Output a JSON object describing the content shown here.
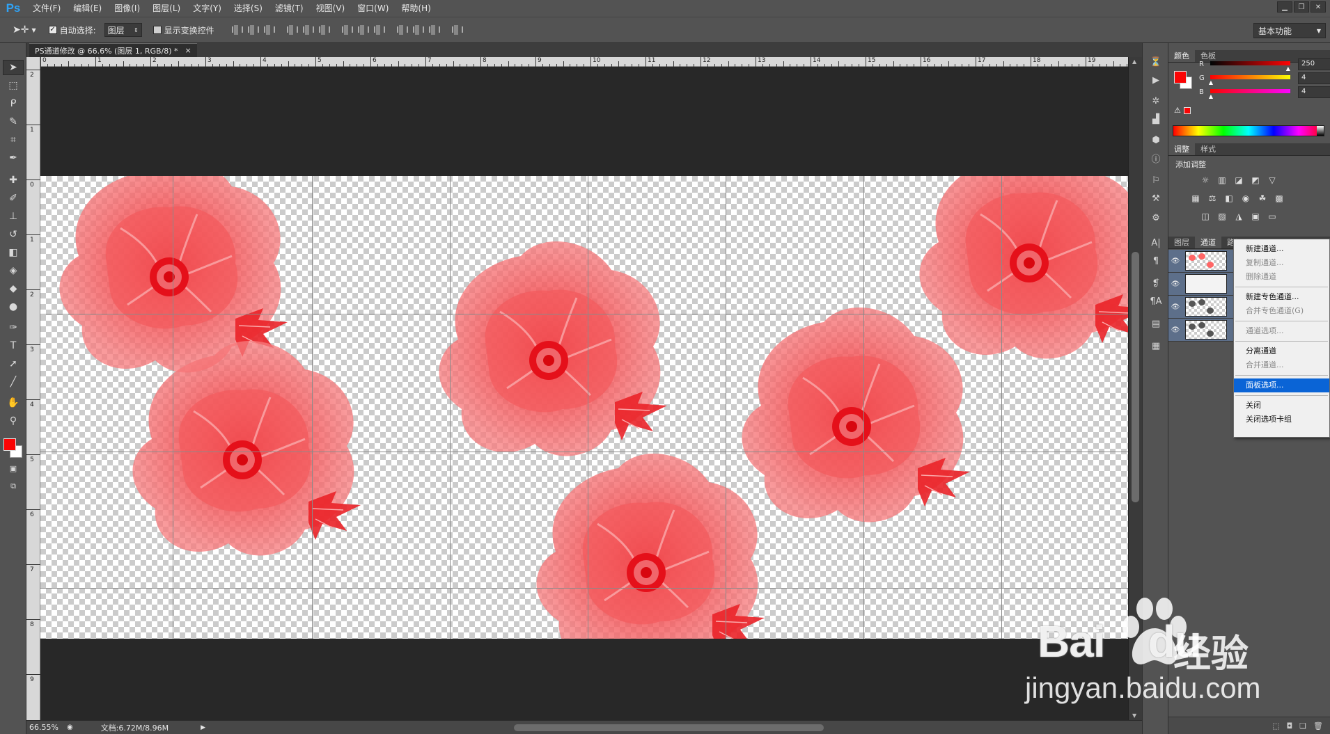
{
  "app": {
    "logo": "Ps"
  },
  "menu": [
    "文件(F)",
    "编辑(E)",
    "图像(I)",
    "图层(L)",
    "文字(Y)",
    "选择(S)",
    "滤镜(T)",
    "视图(V)",
    "窗口(W)",
    "帮助(H)"
  ],
  "options": {
    "auto_select_label": "自动选择:",
    "auto_select_value": "图层",
    "show_transform_label": "显示变换控件",
    "workspace": "基本功能"
  },
  "document": {
    "tab_title": "PS通道修改 @ 66.6% (图层 1, RGB/8) *",
    "close": "×",
    "zoom": "66.55%",
    "doc_info": "文档:6.72M/8.96M"
  },
  "rulers": {
    "h": [
      "0",
      "1",
      "2",
      "3",
      "4",
      "5",
      "6",
      "7",
      "8",
      "9",
      "10",
      "11",
      "12",
      "13",
      "14",
      "15",
      "16",
      "17",
      "18",
      "19"
    ],
    "v": [
      "2",
      "1",
      "0",
      "1",
      "2",
      "3",
      "4",
      "5",
      "6",
      "7",
      "8",
      "9"
    ]
  },
  "color_panel": {
    "tabs": [
      "颜色",
      "色板"
    ],
    "channels": [
      {
        "label": "R",
        "value": "250",
        "level": 0.98
      },
      {
        "label": "G",
        "value": "4",
        "level": 0.016
      },
      {
        "label": "B",
        "value": "4",
        "level": 0.016
      }
    ],
    "foreground": "#fa0404"
  },
  "adjust_panel": {
    "tabs": [
      "调整",
      "样式"
    ],
    "title": "添加调整"
  },
  "layers_panel": {
    "tabs": [
      "图层",
      "通道",
      "路径"
    ]
  },
  "context_menu": {
    "items": [
      {
        "label": "新建通道...",
        "disabled": false
      },
      {
        "label": "复制通道...",
        "disabled": true
      },
      {
        "label": "删除通道",
        "disabled": true
      },
      {
        "sep": true
      },
      {
        "label": "新建专色通道...",
        "disabled": false
      },
      {
        "label": "合并专色通道(G)",
        "disabled": true
      },
      {
        "sep": true
      },
      {
        "label": "通道选项...",
        "disabled": true
      },
      {
        "sep": true
      },
      {
        "label": "分离通道",
        "disabled": false
      },
      {
        "label": "合并通道...",
        "disabled": true
      },
      {
        "sep": true
      },
      {
        "label": "面板选项...",
        "disabled": false,
        "highlight": true
      },
      {
        "sep": true
      },
      {
        "label": "关闭",
        "disabled": false
      },
      {
        "label": "关闭选项卡组",
        "disabled": false
      }
    ]
  },
  "watermark": {
    "brand": "Bai",
    "brand2": "du",
    "cn": "经验",
    "url": "jingyan.baidu.com"
  }
}
